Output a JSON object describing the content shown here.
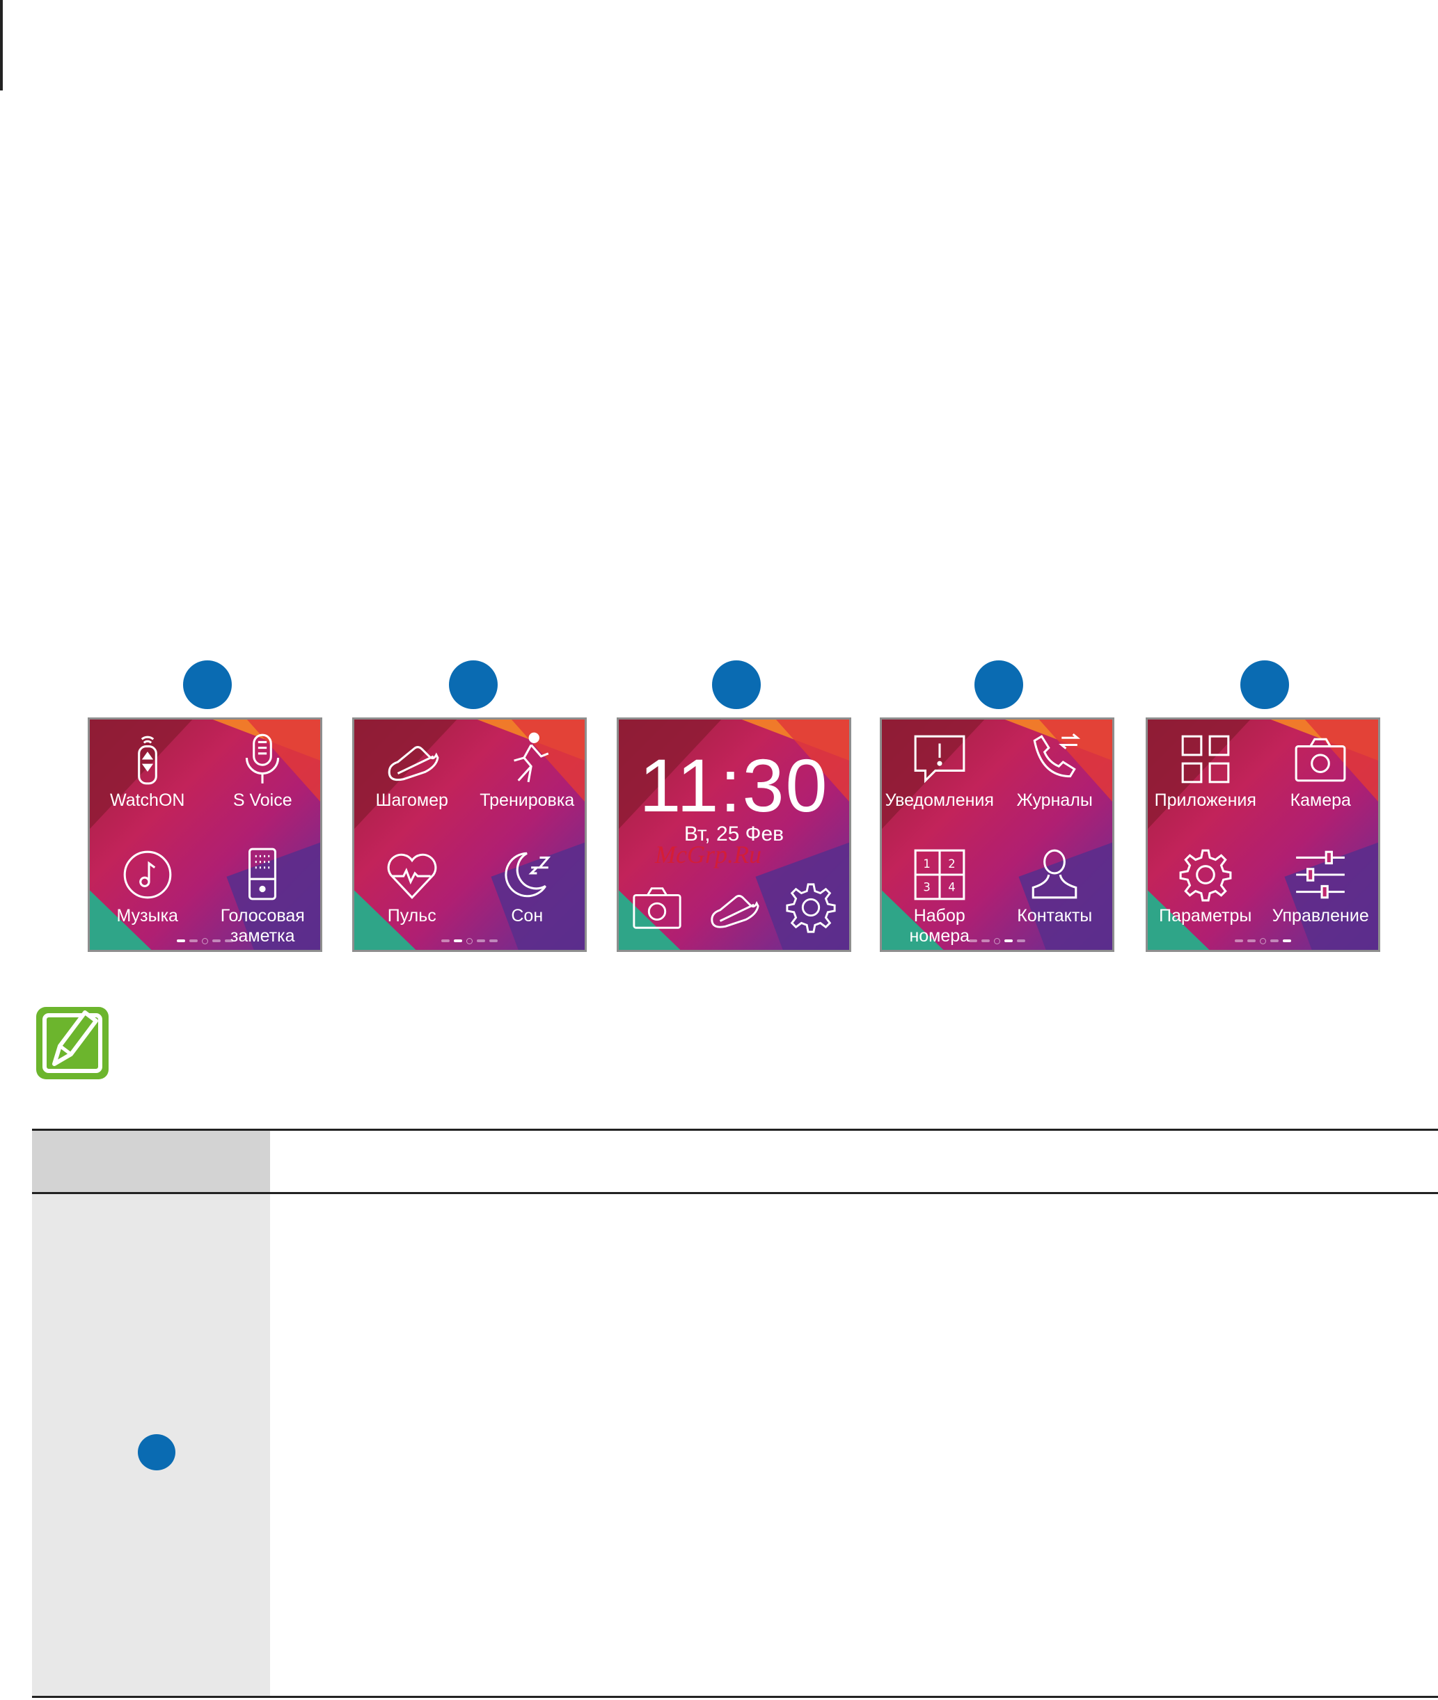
{
  "screens": [
    {
      "cells": [
        {
          "label": "WatchON",
          "icon": "remote-icon"
        },
        {
          "label": "S Voice",
          "icon": "microphone-icon"
        },
        {
          "label": "Музыка",
          "icon": "music-note-icon"
        },
        {
          "label": "Голосовая\nзаметка",
          "icon": "voice-recorder-icon"
        }
      ]
    },
    {
      "cells": [
        {
          "label": "Шагомер",
          "icon": "sneaker-icon"
        },
        {
          "label": "Тренировка",
          "icon": "runner-icon"
        },
        {
          "label": "Пульс",
          "icon": "heart-rate-icon"
        },
        {
          "label": "Сон",
          "icon": "sleep-moon-icon"
        }
      ]
    },
    {
      "clock": {
        "time": "11:30",
        "date": "Вт, 25 Фев",
        "shortcuts": [
          "camera-icon",
          "sneaker-icon",
          "gear-icon"
        ]
      },
      "watermark": "McGrp.Ru"
    },
    {
      "cells": [
        {
          "label": "Уведомления",
          "icon": "notification-icon"
        },
        {
          "label": "Журналы",
          "icon": "call-log-icon"
        },
        {
          "label": "Набор\nномера",
          "icon": "dialpad-icon"
        },
        {
          "label": "Контакты",
          "icon": "contact-icon"
        }
      ]
    },
    {
      "cells": [
        {
          "label": "Приложения",
          "icon": "apps-grid-icon"
        },
        {
          "label": "Камера",
          "icon": "camera-icon"
        },
        {
          "label": "Параметры",
          "icon": "gear-icon"
        },
        {
          "label": "Управление",
          "icon": "sliders-icon"
        }
      ]
    }
  ],
  "colors": {
    "bullet": "#0a6bb2",
    "note_icon": "#6cb52d",
    "table_header": "#d3d3d3",
    "table_col": "#e8e8e8"
  }
}
